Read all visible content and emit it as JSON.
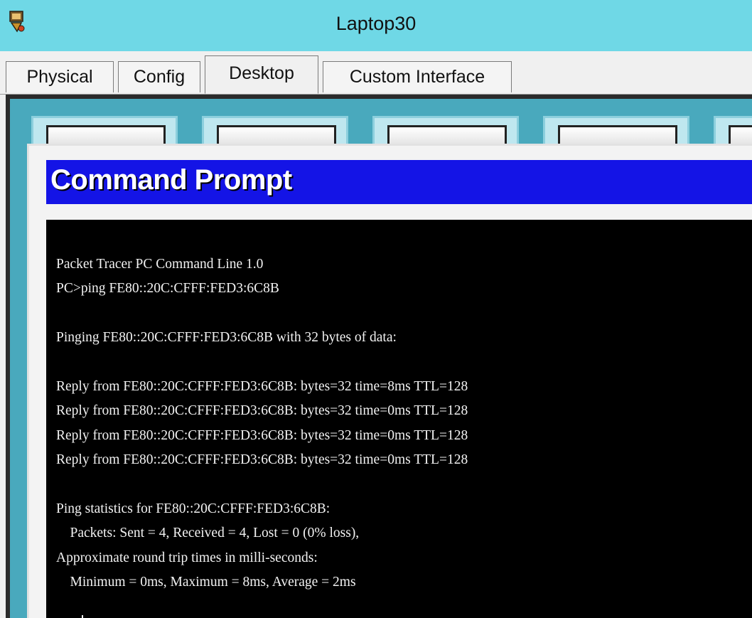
{
  "window": {
    "title": "Laptop30",
    "icon": "packet-tracer-app-icon",
    "titlebar_color": "#6fd8e6"
  },
  "tabs": [
    {
      "label": "Physical",
      "active": false
    },
    {
      "label": "Config",
      "active": false
    },
    {
      "label": "Desktop",
      "active": true
    },
    {
      "label": "Custom Interface",
      "active": false
    }
  ],
  "desktop": {
    "background_color": "#49a9bd",
    "apps": [
      {
        "icon": "app-icon-1"
      },
      {
        "icon": "app-icon-2"
      },
      {
        "icon": "app-icon-3"
      },
      {
        "icon": "app-icon-4"
      },
      {
        "icon": "app-icon-5"
      }
    ]
  },
  "command_prompt": {
    "title": "Command Prompt",
    "titlebar_color": "#1414e6",
    "lines": [
      "Packet Tracer PC Command Line 1.0",
      "PC>ping FE80::20C:CFFF:FED3:6C8B",
      "",
      "Pinging FE80::20C:CFFF:FED3:6C8B with 32 bytes of data:",
      "",
      "Reply from FE80::20C:CFFF:FED3:6C8B: bytes=32 time=8ms TTL=128",
      "Reply from FE80::20C:CFFF:FED3:6C8B: bytes=32 time=0ms TTL=128",
      "Reply from FE80::20C:CFFF:FED3:6C8B: bytes=32 time=0ms TTL=128",
      "Reply from FE80::20C:CFFF:FED3:6C8B: bytes=32 time=0ms TTL=128",
      "",
      "Ping statistics for FE80::20C:CFFF:FED3:6C8B:",
      "    Packets: Sent = 4, Received = 4, Lost = 0 (0% loss),",
      "Approximate round trip times in milli-seconds:",
      "    Minimum = 0ms, Maximum = 8ms, Average = 2ms"
    ]
  }
}
